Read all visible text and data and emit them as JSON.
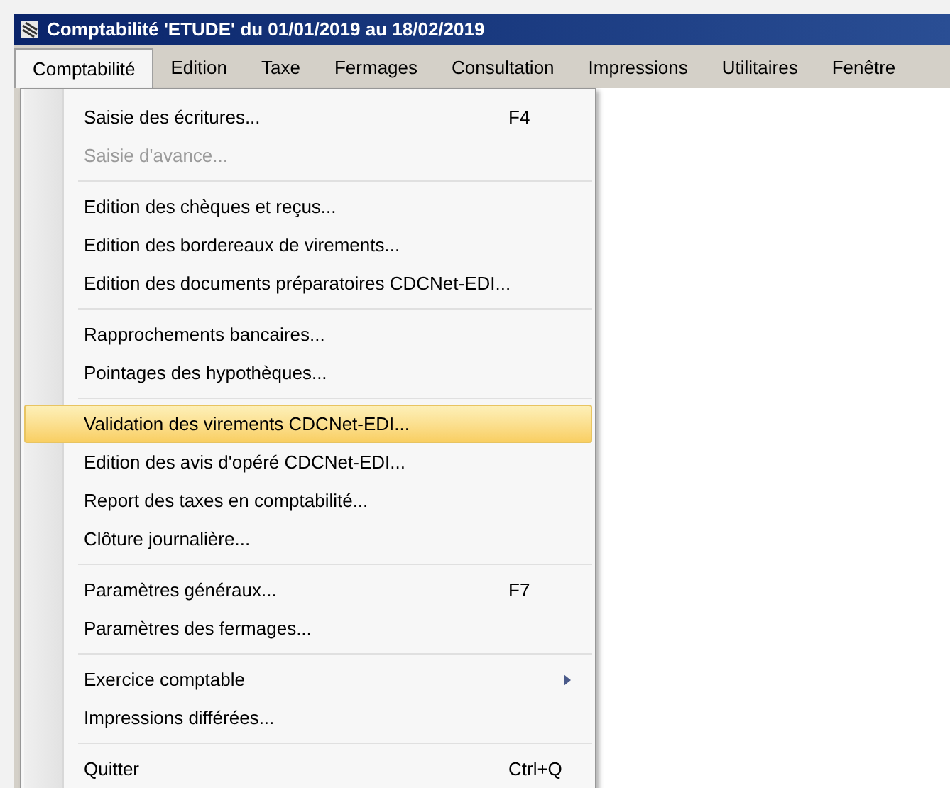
{
  "window": {
    "title": "Comptabilité 'ETUDE' du 01/01/2019 au 18/02/2019"
  },
  "menu_bar": [
    {
      "label": "Comptabilité",
      "selected": true
    },
    {
      "label": "Edition",
      "selected": false
    },
    {
      "label": "Taxe",
      "selected": false
    },
    {
      "label": "Fermages",
      "selected": false
    },
    {
      "label": "Consultation",
      "selected": false
    },
    {
      "label": "Impressions",
      "selected": false
    },
    {
      "label": "Utilitaires",
      "selected": false
    },
    {
      "label": "Fenêtre",
      "selected": false
    }
  ],
  "menu": [
    {
      "kind": "item",
      "label": "Saisie des écritures...",
      "shortcut": "F4",
      "disabled": false,
      "selected": false
    },
    {
      "kind": "item",
      "label": "Saisie d'avance...",
      "disabled": true,
      "selected": false
    },
    {
      "kind": "separator"
    },
    {
      "kind": "item",
      "label": "Edition des chèques et reçus...",
      "disabled": false,
      "selected": false
    },
    {
      "kind": "item",
      "label": "Edition des bordereaux de virements...",
      "disabled": false,
      "selected": false
    },
    {
      "kind": "item",
      "label": "Edition des documents préparatoires CDCNet-EDI...",
      "disabled": false,
      "selected": false
    },
    {
      "kind": "separator"
    },
    {
      "kind": "item",
      "label": "Rapprochements bancaires...",
      "disabled": false,
      "selected": false
    },
    {
      "kind": "item",
      "label": "Pointages des hypothèques...",
      "disabled": false,
      "selected": false
    },
    {
      "kind": "separator"
    },
    {
      "kind": "item",
      "label": "Validation des virements CDCNet-EDI...",
      "disabled": false,
      "selected": true
    },
    {
      "kind": "item",
      "label": "Edition des avis d'opéré CDCNet-EDI...",
      "disabled": false,
      "selected": false
    },
    {
      "kind": "item",
      "label": "Report des taxes en comptabilité...",
      "disabled": false,
      "selected": false
    },
    {
      "kind": "item",
      "label": "Clôture journalière...",
      "disabled": false,
      "selected": false
    },
    {
      "kind": "separator"
    },
    {
      "kind": "item",
      "label": "Paramètres généraux...",
      "shortcut": "F7",
      "disabled": false,
      "selected": false
    },
    {
      "kind": "item",
      "label": "Paramètres des fermages...",
      "disabled": false,
      "selected": false
    },
    {
      "kind": "separator"
    },
    {
      "kind": "submenu",
      "label": "Exercice comptable",
      "disabled": false,
      "selected": false
    },
    {
      "kind": "item",
      "label": "Impressions différées...",
      "disabled": false,
      "selected": false
    },
    {
      "kind": "separator"
    },
    {
      "kind": "item",
      "label": "Quitter",
      "shortcut": "Ctrl+Q",
      "disabled": false,
      "selected": false
    }
  ]
}
